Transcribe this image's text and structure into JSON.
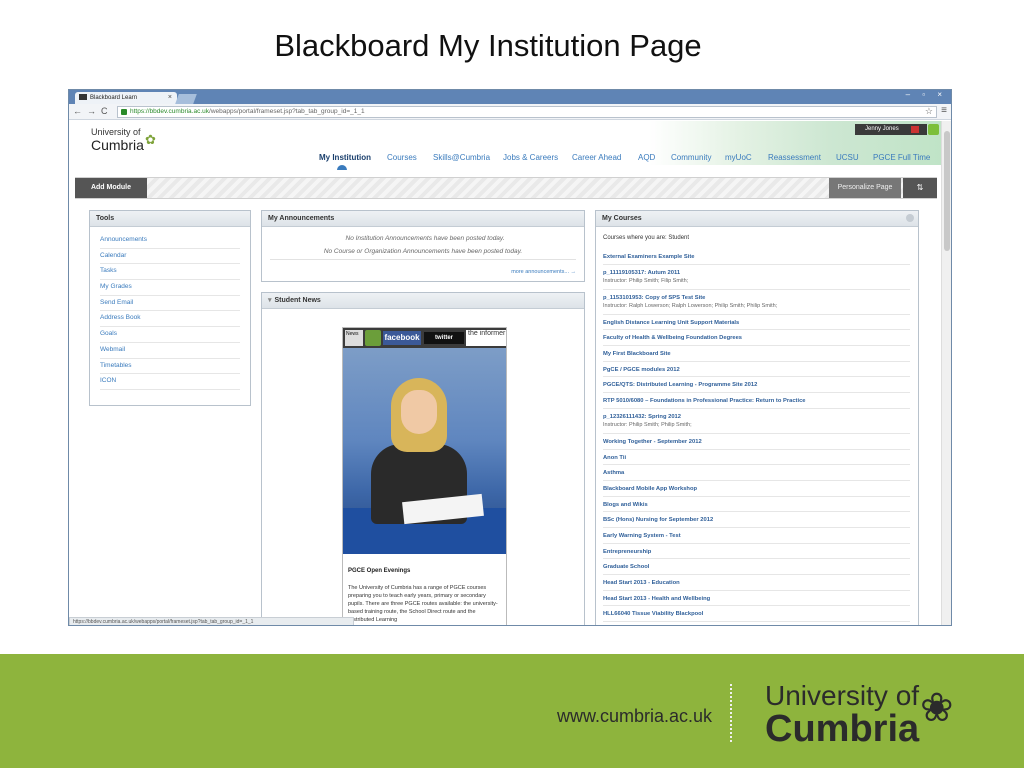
{
  "slide": {
    "title": "Blackboard My Institution Page"
  },
  "browser": {
    "tab_title": "Blackboard Learn",
    "tab_close": "×",
    "address_secure": "https://bbdev.cumbria.ac.uk",
    "address_path": "/webapps/portal/frameset.jsp?tab_tab_group_id=_1_1",
    "status_url": "https://bbdev.cumbria.ac.uk/webapps/portal/frameset.jsp?tab_tab_group_id=_1_1",
    "window_controls": "– ▫ ×"
  },
  "header": {
    "logo_line1": "University of",
    "logo_line2": "Cumbria",
    "user_name": "Jenny Jones",
    "tabs": [
      {
        "label": "My Institution"
      },
      {
        "label": "Courses"
      },
      {
        "label": "Skills@Cumbria"
      },
      {
        "label": "Jobs & Careers"
      },
      {
        "label": "Career Ahead"
      },
      {
        "label": "AQD"
      },
      {
        "label": "Community"
      },
      {
        "label": "myUoC"
      },
      {
        "label": "Reassessment"
      },
      {
        "label": "UCSU"
      },
      {
        "label": "PGCE Full Time"
      }
    ]
  },
  "modulebar": {
    "add_module": "Add Module",
    "personalize": "Personalize Page",
    "reorder": "⇅"
  },
  "tools": {
    "title": "Tools",
    "items": [
      "Announcements",
      "Calendar",
      "Tasks",
      "My Grades",
      "Send Email",
      "Address Book",
      "Goals",
      "Webmail",
      "Timetables",
      "ICON"
    ]
  },
  "announcements": {
    "title": "My Announcements",
    "line1": "No Institution Announcements have been posted today.",
    "line2": "No Course or Organization Announcements have been posted today.",
    "more": "more announcements... →"
  },
  "news": {
    "title": "Student News",
    "news_badge": "News",
    "facebook": "facebook",
    "twitter": "twitter",
    "informer": "the informer",
    "caption_title": "PGCE Open Evenings",
    "caption_body": "The University of Cumbria has a range of PGCE courses preparing you to teach early years, primary or secondary pupils. There are three PGCE routes available: the university-based training route, the School Direct route and the Distributed Learning"
  },
  "courses": {
    "title": "My Courses",
    "intro": "Courses where you are: Student",
    "items": [
      {
        "name": "External Examiners Example Site",
        "instructor": ""
      },
      {
        "name": "p_11119105317: Autum 2011",
        "instructor": "Instructor: Philip Smith;  Filip Smith;"
      },
      {
        "name": "p_1153101953: Copy of SPS Test Site",
        "instructor": "Instructor: Ralph Lowerson;  Ralph Lowerson;  Philip Smith;  Philip Smith;"
      },
      {
        "name": "English Distance Learning Unit Support Materials",
        "instructor": ""
      },
      {
        "name": "Faculty of Health & Wellbeing Foundation Degrees",
        "instructor": ""
      },
      {
        "name": "My First Blackboard Site",
        "instructor": ""
      },
      {
        "name": "PgCE / PGCE modules 2012",
        "instructor": ""
      },
      {
        "name": "PGCE/QTS: Distributed Learning - Programme Site 2012",
        "instructor": ""
      },
      {
        "name": "RTP 5010/6080 – Foundations in Professional Practice: Return to Practice",
        "instructor": ""
      },
      {
        "name": "p_12326111432: Spring 2012",
        "instructor": "Instructor: Philip Smith;  Philip Smith;"
      },
      {
        "name": "Working Together - September 2012",
        "instructor": ""
      },
      {
        "name": "Anon Tii",
        "instructor": ""
      },
      {
        "name": "Asthma",
        "instructor": ""
      },
      {
        "name": "Blackboard Mobile App Workshop",
        "instructor": ""
      },
      {
        "name": "Blogs and Wikis",
        "instructor": ""
      },
      {
        "name": "BSc (Hons) Nursing for September 2012",
        "instructor": ""
      },
      {
        "name": "Early Warning System - Test",
        "instructor": ""
      },
      {
        "name": "Entrepreneurship",
        "instructor": ""
      },
      {
        "name": "Graduate School",
        "instructor": ""
      },
      {
        "name": "Head Start 2013 - Education",
        "instructor": ""
      },
      {
        "name": "Head Start 2013 - Health and Wellbeing",
        "instructor": ""
      },
      {
        "name": "HLL66040 Tissue Viability Blackpool",
        "instructor": ""
      }
    ]
  },
  "footer": {
    "url": "www.cumbria.ac.uk",
    "uni_line1": "University of",
    "uni_line2": "Cumbria"
  },
  "colors": {
    "footer_green": "#8eb43d",
    "link_blue": "#3a7bbd",
    "chrome_blue": "#5f84b5"
  }
}
